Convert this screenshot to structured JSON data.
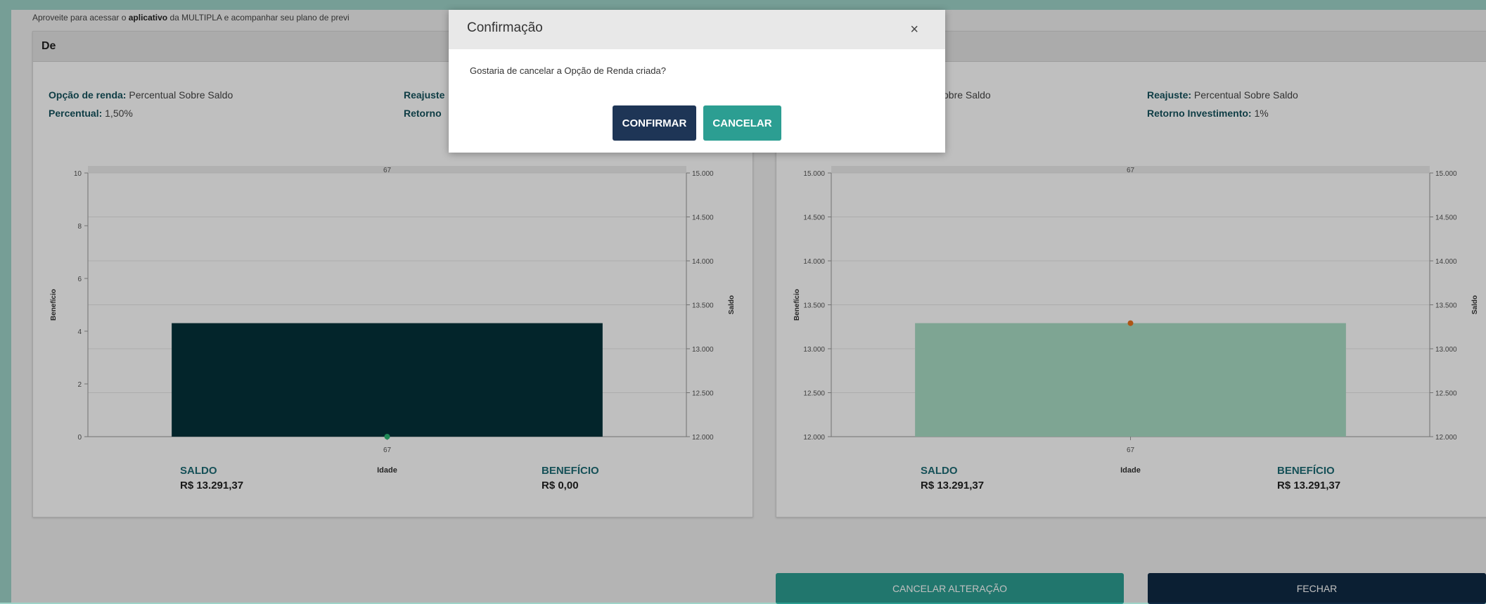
{
  "notice": {
    "prefix": "Aproveite para acessar o ",
    "bold": "aplicativo",
    "suffix": " da MULTIPLA e acompanhar seu plano de previ"
  },
  "left_panel": {
    "title": "De",
    "opcao_label": "Opção de renda:",
    "opcao_value": " Percentual Sobre Saldo",
    "percentual_label": "Percentual:",
    "percentual_value": " 1,50%",
    "reajuste_label": "Reajuste",
    "retorno_label": "Retorno",
    "saldo_label": "SALDO",
    "saldo_value": "R$ 13.291,37",
    "beneficio_label": "BENEFÍCIO",
    "beneficio_value": "R$ 0,00"
  },
  "right_panel": {
    "opcao_value_partial": "obre Saldo",
    "reajuste_label": "Reajuste:",
    "reajuste_value": " Percentual Sobre Saldo",
    "retorno_label": "Retorno Investimento:",
    "retorno_value": " 1%",
    "saldo_label": "SALDO",
    "saldo_value": "R$ 13.291,37",
    "beneficio_label": "BENEFÍCIO",
    "beneficio_value": "R$ 13.291,37"
  },
  "chart_data": [
    {
      "type": "bar",
      "xlabel": "Idade",
      "ylabel": "Benefício",
      "y2label": "Saldo",
      "categories": [
        "67"
      ],
      "bar_axis": "right",
      "bar_values": [
        13291.37
      ],
      "point_axis": "left",
      "point_values": [
        0
      ],
      "ylim": [
        0,
        10
      ],
      "y_ticks": [
        "0",
        "2",
        "4",
        "6",
        "8",
        "10"
      ],
      "y2lim": [
        12000,
        15000
      ],
      "y2_ticks": [
        "12.000",
        "12.500",
        "13.000",
        "13.500",
        "14.000",
        "14.500",
        "15.000"
      ],
      "top_label": "67",
      "bar_color": "#04323a",
      "point_color": "#2bb673"
    },
    {
      "type": "bar",
      "xlabel": "Idade",
      "ylabel": "Benefício",
      "y2label": "Saldo",
      "categories": [
        "67"
      ],
      "bar_axis": "right",
      "bar_values": [
        13291.37
      ],
      "point_axis": "left",
      "point_values": [
        13291.37
      ],
      "ylim": [
        12000,
        15000
      ],
      "y_ticks": [
        "12.000",
        "12.500",
        "13.000",
        "13.500",
        "14.000",
        "14.500",
        "15.000"
      ],
      "y2lim": [
        12000,
        15000
      ],
      "y2_ticks": [
        "12.000",
        "12.500",
        "13.000",
        "13.500",
        "14.000",
        "14.500",
        "15.000"
      ],
      "top_label": "67",
      "bar_color": "#a8dcc4",
      "point_color": "#e8731e"
    }
  ],
  "buttons": {
    "cancelar_alteracao": "CANCELAR ALTERAÇÃO",
    "fechar": "FECHAR"
  },
  "modal": {
    "title": "Confirmação",
    "close": "×",
    "message": "Gostaria de cancelar a Opção de Renda criada?",
    "confirm": "CONFIRMAR",
    "cancel": "CANCELAR"
  },
  "colors": {
    "background": "#9ed3c8",
    "label_teal": "#15525c",
    "confirm_button": "#1e3556",
    "cancel_button": "#2c9e92",
    "cancelar_alteracao_button": "#2c9e92",
    "fechar_button": "#0f2a44"
  }
}
